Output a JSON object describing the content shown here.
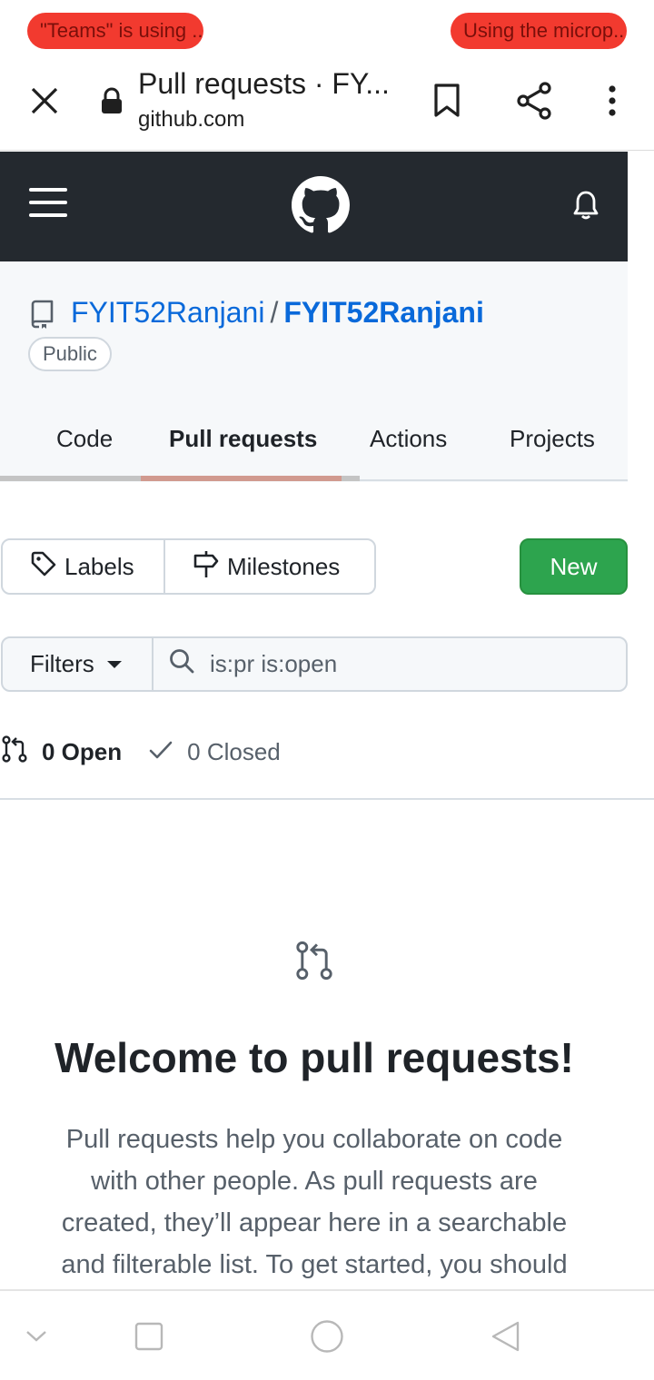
{
  "status": {
    "left_pill": "\"Teams\" is using ...",
    "right_pill": "Using the microp..."
  },
  "browser": {
    "title": "Pull requests · FY...",
    "domain": "github.com",
    "icons": [
      "close-icon",
      "lock-icon",
      "bookmark-icon",
      "share-icon",
      "more-vert-icon"
    ]
  },
  "github_header": {
    "icons": [
      "hamburger-menu-icon",
      "github-logo-icon",
      "bell-icon"
    ]
  },
  "repo": {
    "owner": "FYIT52Ranjani",
    "separator": "/",
    "name": "FYIT52Ranjani",
    "visibility": "Public"
  },
  "tabs": [
    {
      "label": "Code",
      "active": false
    },
    {
      "label": "Pull requests",
      "active": true
    },
    {
      "label": "Actions",
      "active": false
    },
    {
      "label": "Projects",
      "active": false
    }
  ],
  "toolbar": {
    "labels": "Labels",
    "milestones": "Milestones",
    "new": "New"
  },
  "filters": {
    "button": "Filters",
    "query": "is:pr is:open"
  },
  "state": {
    "open": "0 Open",
    "closed": "0 Closed"
  },
  "blank_slate": {
    "title": "Welcome to pull requests!",
    "text": "Pull requests help you collaborate on code with other people. As pull requests are created, they’ll appear here in a searchable and filterable list. To get started, you should"
  },
  "colors": {
    "header_bg": "#24292f",
    "link": "#0969da",
    "new_button": "#2da44e",
    "pill": "#f23a2f"
  }
}
